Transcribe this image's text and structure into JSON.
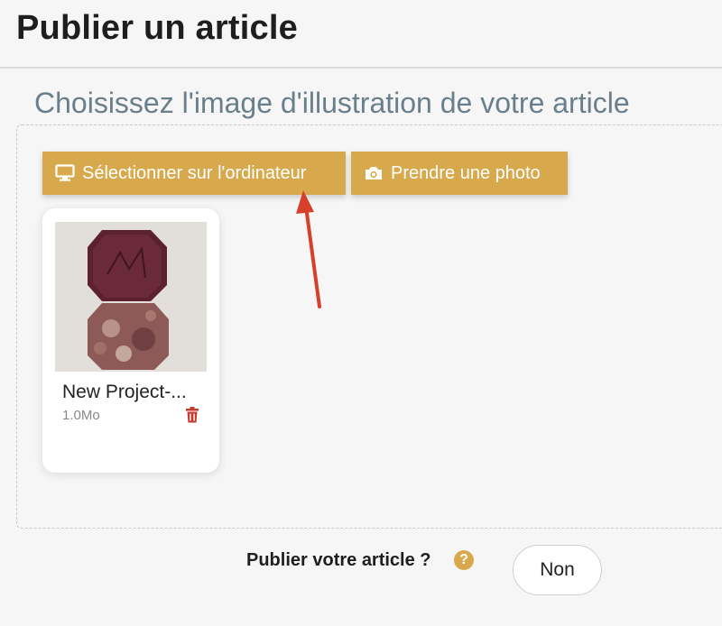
{
  "header": {
    "title": "Publier un article"
  },
  "section": {
    "subtitle": "Choisissez l'image d'illustration de votre article"
  },
  "buttons": {
    "select_computer": {
      "label": "Sélectionner sur l'ordinateur",
      "icon": "monitor-icon"
    },
    "take_photo": {
      "label": "Prendre une photo",
      "icon": "camera-icon"
    }
  },
  "file": {
    "name": "New Project-...",
    "size": "1.0Mo",
    "delete_icon": "trash-icon"
  },
  "publish": {
    "label": "Publier votre article ?",
    "help": "?",
    "toggle_value": "Non"
  },
  "colors": {
    "accent": "#d8a94c",
    "subtitle": "#6a7f8c",
    "delete": "#c23b2e",
    "arrow": "#d6402b"
  }
}
